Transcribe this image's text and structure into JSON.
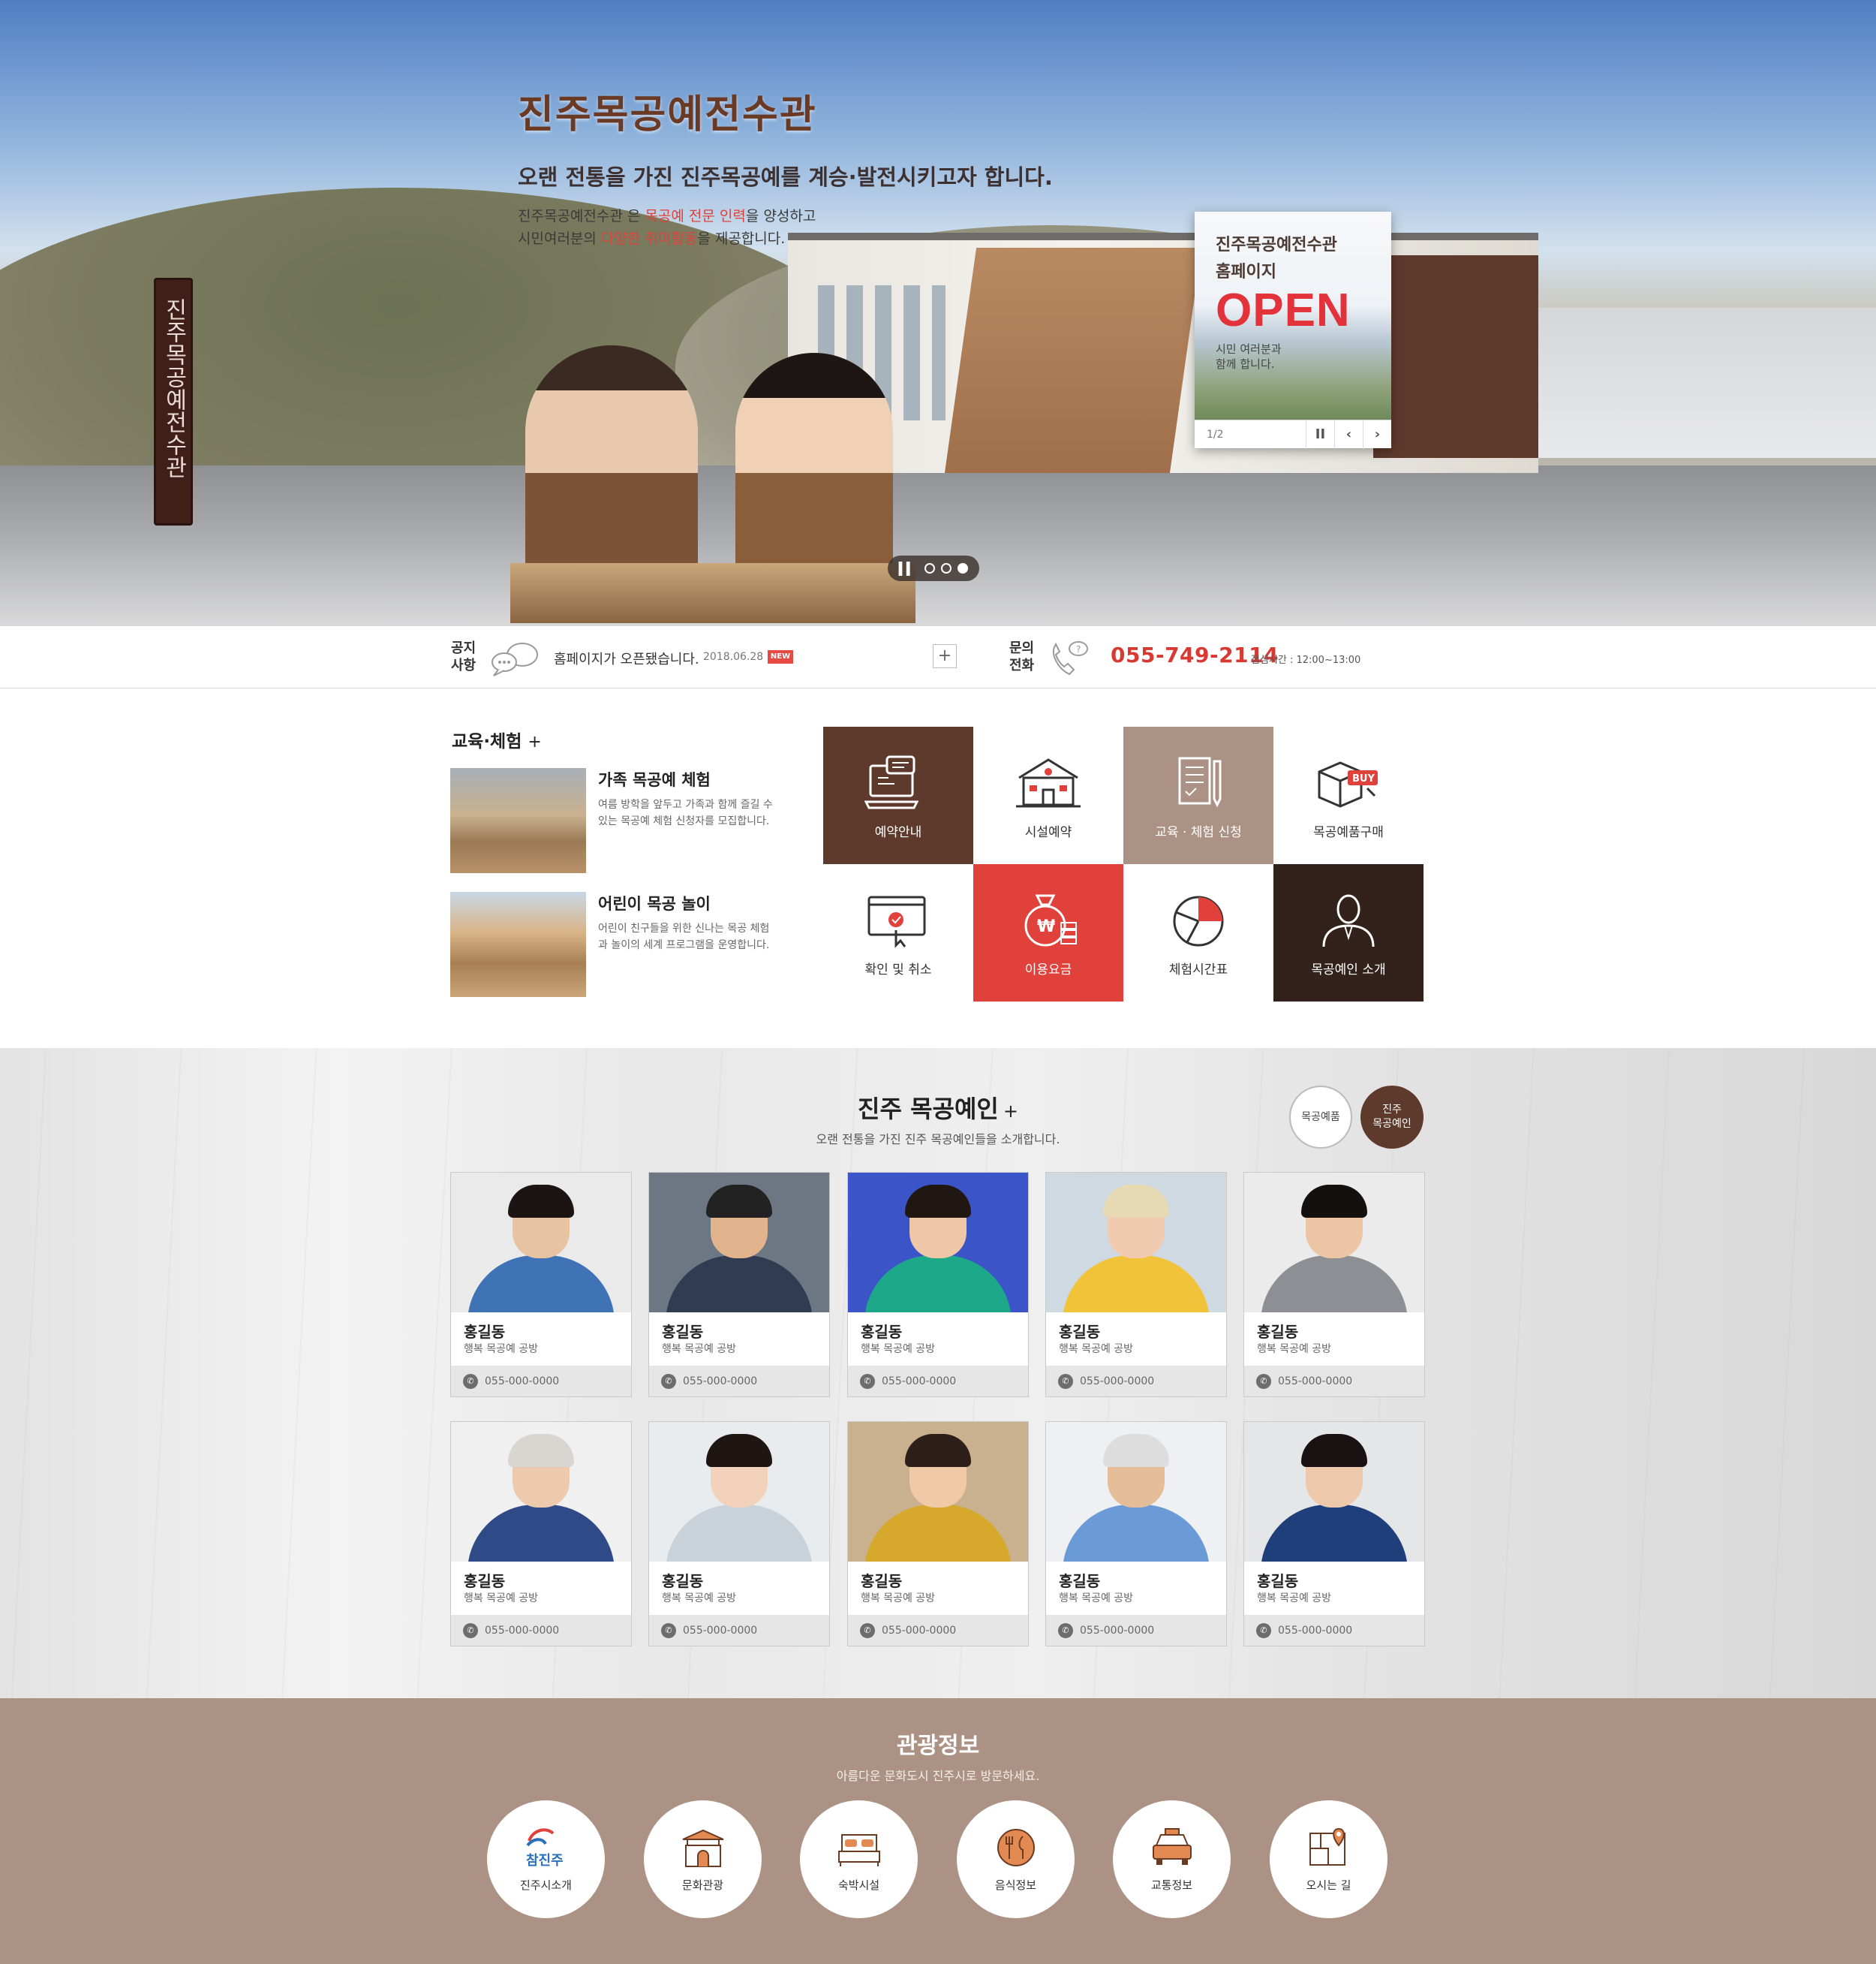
{
  "hero": {
    "title": "진주목공예전수관",
    "subtitle": "오랜 전통을 가진 진주목공예를 계승·발전시키고자 합니다.",
    "desc1_pre": "진주목공예전수관",
    "desc1_mid": " 은 ",
    "desc1_hl": "목공예 전문 인력",
    "desc1_post": "을 양성하고",
    "desc2_pre": "시민여러분의 ",
    "desc2_hl": "다양한 취미활동",
    "desc2_post": "을 제공합니다.",
    "sign_text": "진주목공예전수관",
    "slider": {
      "pause_icon": "pause-icon",
      "dots": 3,
      "active_dot": 3
    }
  },
  "popup": {
    "line1": "진주목공예전수관",
    "line2": "홈페이지",
    "open": "OPEN",
    "small1": "시민 여러분과",
    "small2": "함께 합니다.",
    "page": "1/2",
    "pause": "II",
    "prev": "‹",
    "next": "›"
  },
  "infobar": {
    "notice_label_1": "공지",
    "notice_label_2": "사항",
    "notice_text": "홈페이지가 오픈됐습니다.",
    "notice_date": "2018.06.28",
    "new_badge": "NEW",
    "more": "+",
    "contact_label_1": "문의",
    "contact_label_2": "전화",
    "phone": "055-749-2114",
    "lunch": "점심시간 : 12:00~13:00"
  },
  "education": {
    "title": "교육·체험",
    "plus": "+",
    "items": [
      {
        "title": "가족 목공예 체험",
        "desc": "여름 방학을 앞두고 가족과 함께 즐길 수 있는 목공예 체험 신청자를 모집합니다."
      },
      {
        "title": "어린이 목공 놀이",
        "desc": "어린이 친구들을 위한 신나는 목공 체험과 놀이의 세계 프로그램을 운영합니다."
      }
    ]
  },
  "menu": [
    {
      "label": "예약안내",
      "icon": "reservation-monitor-icon",
      "bg": "#5e3a2c",
      "fg": "#ffffff"
    },
    {
      "label": "시설예약",
      "icon": "facility-building-icon",
      "bg": "#ffffff",
      "fg": "#333333"
    },
    {
      "label": "교육 · 체험 신청",
      "icon": "application-form-icon",
      "bg": "#ab9284",
      "fg": "#ffffff"
    },
    {
      "label": "목공예품구매",
      "icon": "buy-box-icon",
      "bg": "#ffffff",
      "fg": "#333333"
    },
    {
      "label": "확인 및 취소",
      "icon": "confirm-cancel-icon",
      "bg": "#ffffff",
      "fg": "#333333"
    },
    {
      "label": "이용요금",
      "icon": "fee-moneybag-icon",
      "bg": "#e0413b",
      "fg": "#ffffff"
    },
    {
      "label": "체험시간표",
      "icon": "schedule-piechart-icon",
      "bg": "#ffffff",
      "fg": "#333333"
    },
    {
      "label": "목공예인 소개",
      "icon": "artisan-person-icon",
      "bg": "#33221c",
      "fg": "#ffffff"
    }
  ],
  "artisans": {
    "title": "진주 목공예인",
    "plus": "+",
    "subtitle": "오랜 전통을 가진 진주 목공예인들을 소개합니다.",
    "tabs": [
      {
        "label": "목공예품"
      },
      {
        "label": "진주\n목공예인"
      }
    ],
    "cards": [
      {
        "name": "홍길동",
        "shop": "행복 목공예 공방",
        "phone": "055-000-0000",
        "bg": "#eaeaea",
        "hair": "#1b1412",
        "skin": "#e8c3a2",
        "body": "#3f73b5"
      },
      {
        "name": "홍길동",
        "shop": "행복 목공예 공방",
        "phone": "055-000-0000",
        "bg": "#6d7784",
        "hair": "#222222",
        "skin": "#e1b48d",
        "body": "#2f3c52"
      },
      {
        "name": "홍길동",
        "shop": "행복 목공예 공방",
        "phone": "055-000-0000",
        "bg": "#3b55c9",
        "hair": "#201612",
        "skin": "#edc7a6",
        "body": "#1ea88a"
      },
      {
        "name": "홍길동",
        "shop": "행복 목공예 공방",
        "phone": "055-000-0000",
        "bg": "#cfd9e2",
        "hair": "#e8d9b5",
        "skin": "#f0cbb0",
        "body": "#f1c33a"
      },
      {
        "name": "홍길동",
        "shop": "행복 목공예 공방",
        "phone": "055-000-0000",
        "bg": "#ebebeb",
        "hair": "#151010",
        "skin": "#ecc6a4",
        "body": "#8e8f95"
      },
      {
        "name": "홍길동",
        "shop": "행복 목공예 공방",
        "phone": "055-000-0000",
        "bg": "#f0f0f0",
        "hair": "#d9d6d2",
        "skin": "#edc9ad",
        "body": "#2f4a86"
      },
      {
        "name": "홍길동",
        "shop": "행복 목공예 공방",
        "phone": "055-000-0000",
        "bg": "#e9ecee",
        "hair": "#1f1614",
        "skin": "#f2d2bb",
        "body": "#c9d2d9"
      },
      {
        "name": "홍길동",
        "shop": "행복 목공예 공방",
        "phone": "055-000-0000",
        "bg": "#c9b08e",
        "hair": "#2c1e18",
        "skin": "#f0caa6",
        "body": "#d6a92d"
      },
      {
        "name": "홍길동",
        "shop": "행복 목공예 공방",
        "phone": "055-000-0000",
        "bg": "#eef0f3",
        "hair": "#dddddd",
        "skin": "#e6bd99",
        "body": "#6b9bd6"
      },
      {
        "name": "홍길동",
        "shop": "행복 목공예 공방",
        "phone": "055-000-0000",
        "bg": "#e4e6e8",
        "hair": "#1a1212",
        "skin": "#eec8ab",
        "body": "#1f3f7a"
      }
    ]
  },
  "tourism": {
    "title": "관광정보",
    "subtitle": "아름다운 문화도시 진주시로 방문하세요.",
    "items": [
      {
        "label": "진주시소개",
        "icon": "jinju-logo-icon"
      },
      {
        "label": "문화관광",
        "icon": "castle-gate-icon"
      },
      {
        "label": "숙박시설",
        "icon": "bed-icon"
      },
      {
        "label": "음식정보",
        "icon": "fork-knife-icon"
      },
      {
        "label": "교통정보",
        "icon": "taxi-icon"
      },
      {
        "label": "오시는 길",
        "icon": "map-pin-icon"
      }
    ],
    "logo_text": "참진주"
  }
}
